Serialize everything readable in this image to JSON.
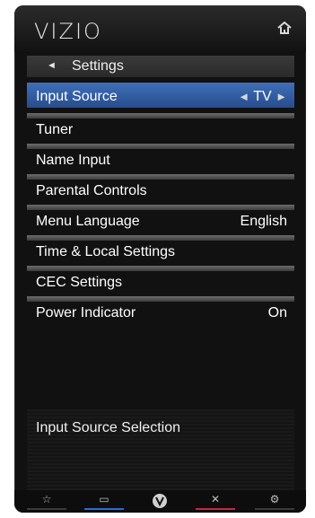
{
  "brand": {
    "logo_text": "VIZIO"
  },
  "header": {
    "back_arrow": "◄",
    "title": "Settings",
    "home_icon": "home-icon"
  },
  "menu": {
    "items": [
      {
        "label": "Input Source",
        "value": "TV",
        "selected": true,
        "left_arrow": "◄",
        "right_arrow": "►"
      },
      {
        "label": "Tuner",
        "value": ""
      },
      {
        "label": "Name Input",
        "value": ""
      },
      {
        "label": "Parental Controls",
        "value": ""
      },
      {
        "label": "Menu Language",
        "value": "English"
      },
      {
        "label": "Time & Local Settings",
        "value": ""
      },
      {
        "label": "CEC Settings",
        "value": ""
      },
      {
        "label": "Power Indicator",
        "value": "On"
      }
    ]
  },
  "info": {
    "text": "Input Source Selection"
  },
  "bottom_buttons": [
    {
      "name": "favorite",
      "icon": "☆",
      "accent": "#3a3a3a"
    },
    {
      "name": "widgets",
      "icon": "▭",
      "accent": "#2d6bd6"
    },
    {
      "name": "vizio",
      "icon": "V",
      "accent": "#3a3a3a"
    },
    {
      "name": "close",
      "icon": "✕",
      "accent": "#c1273f"
    },
    {
      "name": "settings",
      "icon": "⚙",
      "accent": "#3a3a3a"
    }
  ],
  "colors": {
    "selection": "#2f5fa8",
    "panel": "#111111"
  }
}
